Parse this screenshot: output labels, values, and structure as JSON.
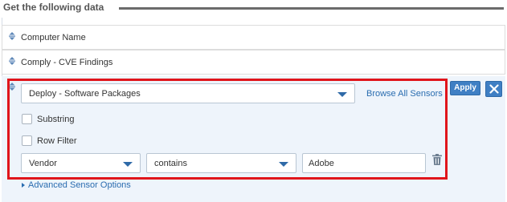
{
  "header": {
    "title": "Get the following data"
  },
  "sensors": [
    {
      "label": "Computer Name"
    },
    {
      "label": "Comply - CVE Findings"
    }
  ],
  "active_sensor": {
    "selected": "Deploy - Software Packages",
    "browse_label": "Browse All Sensors",
    "apply_label": "Apply",
    "substring_label": "Substring",
    "substring_checked": false,
    "row_filter_label": "Row Filter",
    "row_filter_checked": false,
    "filter": {
      "field": "Vendor",
      "operator": "contains",
      "value": "Adobe"
    },
    "advanced_label": "Advanced Sensor Options"
  },
  "colors": {
    "accent": "#3f7fc4",
    "link": "#2a6db0",
    "highlight": "#e0151b",
    "active_bg": "#eef4fb"
  },
  "icons": [
    "drag-handle-icon",
    "chevron-down-icon",
    "trash-icon",
    "close-icon",
    "caret-right-icon"
  ]
}
